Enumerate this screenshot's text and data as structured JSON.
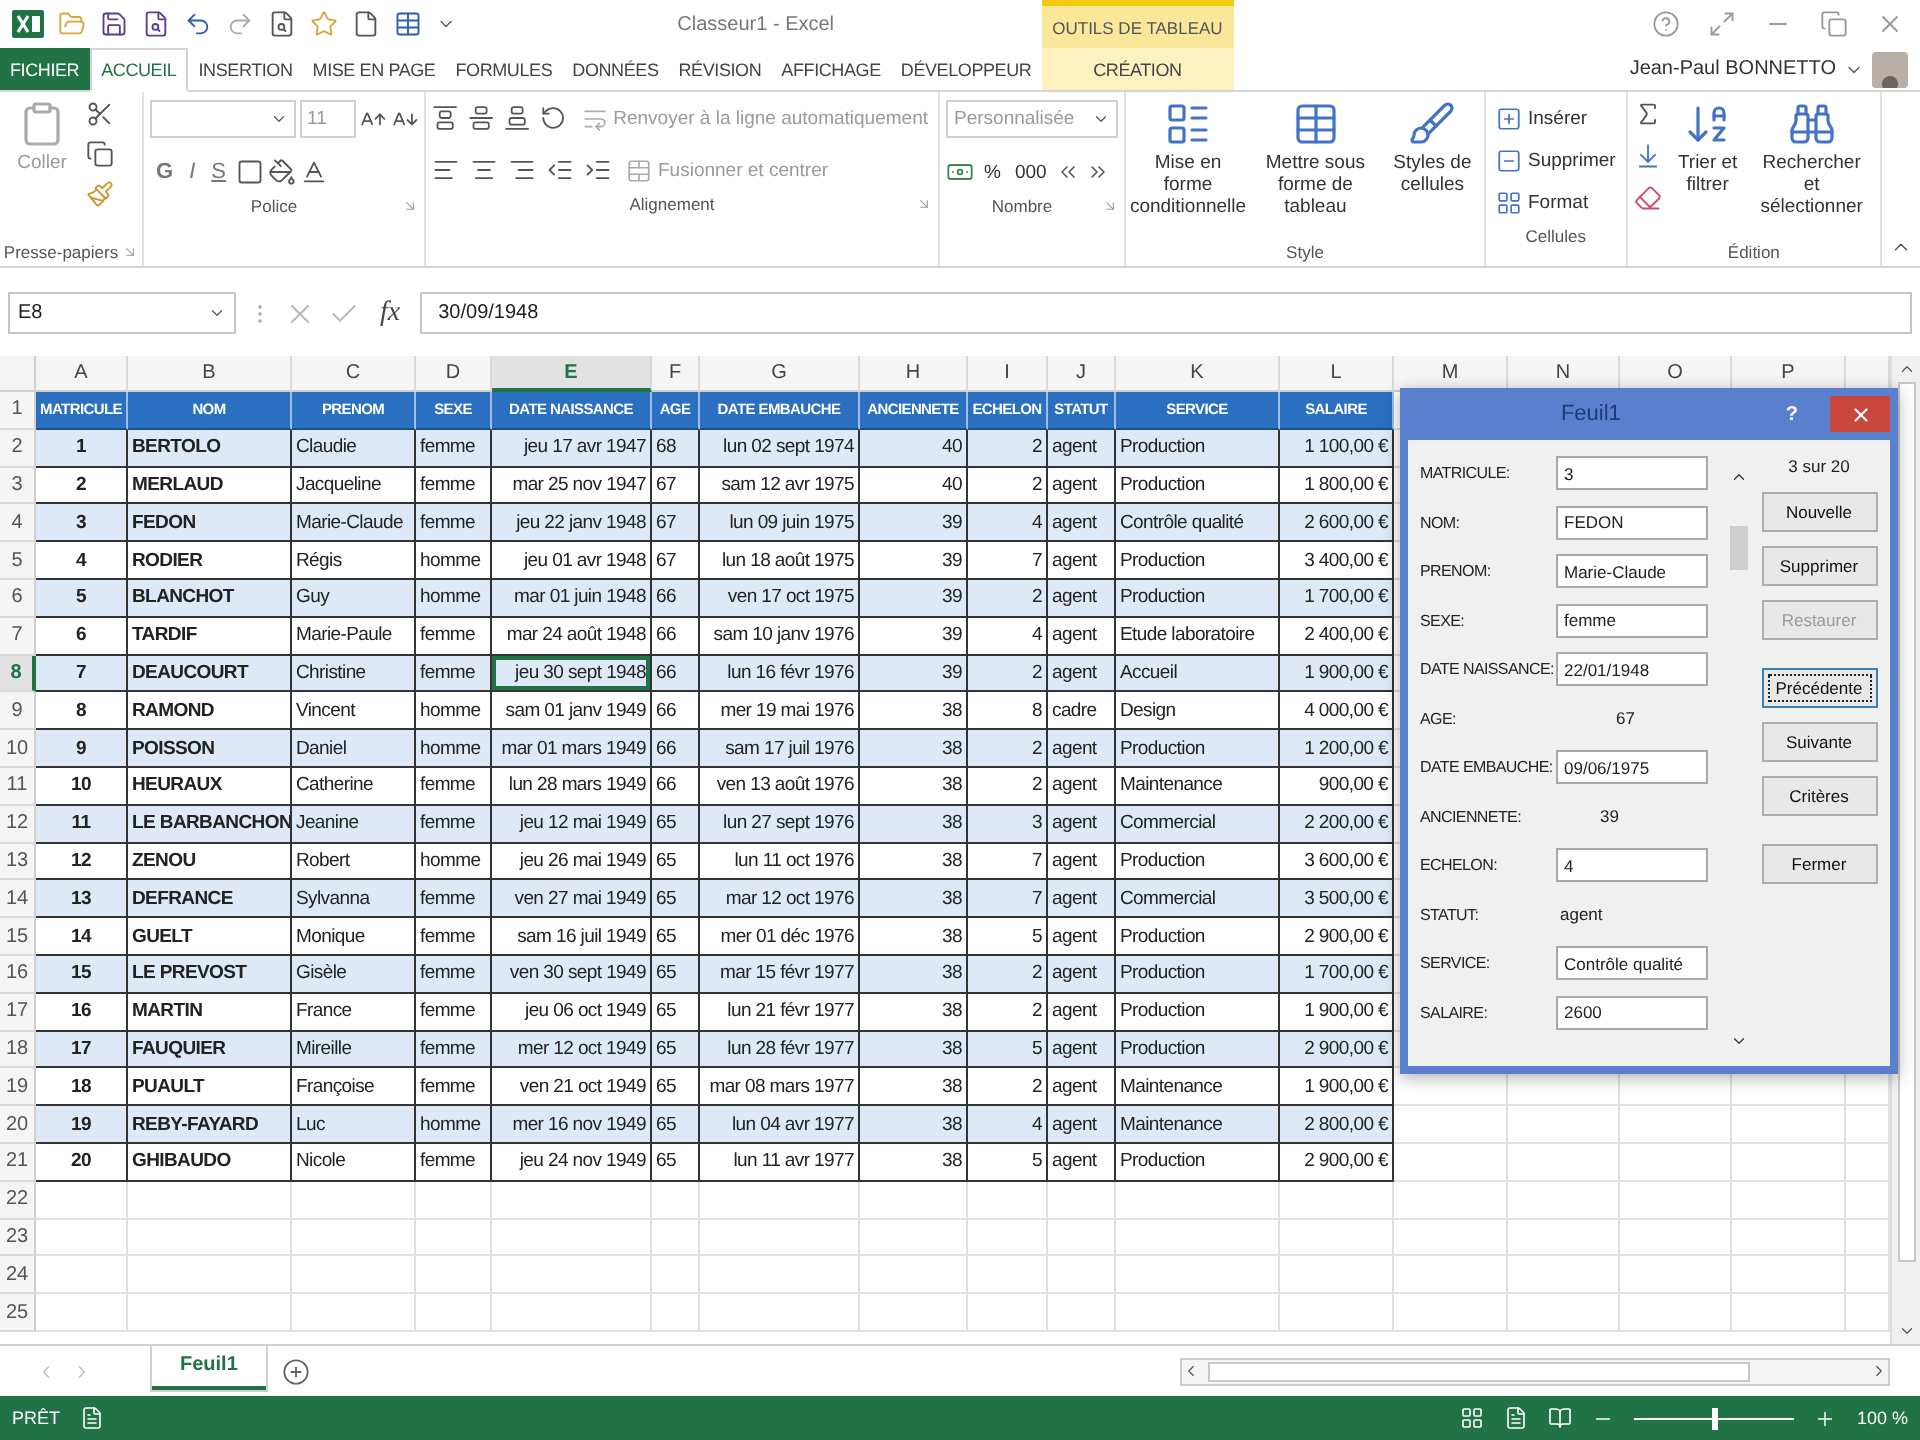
{
  "title_bar": {
    "app_title": "Classeur1 - Excel",
    "contextual_group": "OUTILS DE TABLEAU"
  },
  "tabs": [
    {
      "label": "FICHIER",
      "kind": "file",
      "selected": false
    },
    {
      "label": "ACCUEIL",
      "kind": "normal",
      "selected": true
    },
    {
      "label": "INSERTION",
      "kind": "normal",
      "selected": false
    },
    {
      "label": "MISE EN PAGE",
      "kind": "normal",
      "selected": false
    },
    {
      "label": "FORMULES",
      "kind": "normal",
      "selected": false
    },
    {
      "label": "DONNÉES",
      "kind": "normal",
      "selected": false
    },
    {
      "label": "RÉVISION",
      "kind": "normal",
      "selected": false
    },
    {
      "label": "AFFICHAGE",
      "kind": "normal",
      "selected": false
    },
    {
      "label": "DÉVELOPPEUR",
      "kind": "normal",
      "selected": false
    },
    {
      "label": "CRÉATION",
      "kind": "contextual",
      "selected": false
    }
  ],
  "user": {
    "name": "Jean-Paul BONNETTO"
  },
  "ribbon": [
    {
      "kind": "clipboard",
      "name": "Presse-papiers",
      "commands": [
        {
          "label": "Coller",
          "disabled": true
        }
      ]
    },
    {
      "kind": "font",
      "name": "Police",
      "size": "11",
      "styles": [
        "G",
        "I",
        "S"
      ]
    },
    {
      "kind": "alignment",
      "name": "Alignement",
      "commands": [
        {
          "label": "Renvoyer à la ligne automatiquement",
          "disabled": true
        },
        {
          "label": "Fusionner et centrer",
          "disabled": true
        }
      ]
    },
    {
      "kind": "number",
      "name": "Nombre",
      "format": "Personnalisée",
      "symbols": [
        "%",
        "000"
      ]
    },
    {
      "kind": "style",
      "name": "Style",
      "commands": [
        {
          "label": "Mise en forme conditionnelle",
          "disabled": false
        },
        {
          "label": "Mettre sous forme de tableau",
          "disabled": false
        },
        {
          "label": "Styles de cellules",
          "disabled": false
        }
      ]
    },
    {
      "kind": "cells",
      "name": "Cellules",
      "commands": [
        {
          "label": "Insérer",
          "disabled": false
        },
        {
          "label": "Supprimer",
          "disabled": false
        },
        {
          "label": "Format",
          "disabled": false
        }
      ]
    },
    {
      "kind": "editing",
      "name": "Édition",
      "commands": [
        {
          "label": "Trier et filtrer",
          "disabled": false
        },
        {
          "label": "Rechercher et sélectionner",
          "disabled": false
        }
      ]
    }
  ],
  "formula_bar": {
    "name_box": "E8",
    "function_button": "fx",
    "formula": "30/09/1948"
  },
  "sheet": {
    "columns": [
      {
        "label": "A",
        "selected": false
      },
      {
        "label": "B",
        "selected": false
      },
      {
        "label": "C",
        "selected": false
      },
      {
        "label": "D",
        "selected": false
      },
      {
        "label": "E",
        "selected": true
      },
      {
        "label": "F",
        "selected": false
      },
      {
        "label": "G",
        "selected": false
      },
      {
        "label": "H",
        "selected": false
      },
      {
        "label": "I",
        "selected": false
      },
      {
        "label": "J",
        "selected": false
      },
      {
        "label": "K",
        "selected": false
      },
      {
        "label": "L",
        "selected": false
      },
      {
        "label": "M",
        "selected": false
      },
      {
        "label": "N",
        "selected": false
      },
      {
        "label": "O",
        "selected": false
      },
      {
        "label": "P",
        "selected": false
      }
    ],
    "row_numbers": [
      {
        "label": "1",
        "selected": false
      },
      {
        "label": "2",
        "selected": false
      },
      {
        "label": "3",
        "selected": false
      },
      {
        "label": "4",
        "selected": false
      },
      {
        "label": "5",
        "selected": false
      },
      {
        "label": "6",
        "selected": false
      },
      {
        "label": "7",
        "selected": false
      },
      {
        "label": "8",
        "selected": true
      },
      {
        "label": "9",
        "selected": false
      },
      {
        "label": "10",
        "selected": false
      },
      {
        "label": "11",
        "selected": false
      },
      {
        "label": "12",
        "selected": false
      },
      {
        "label": "13",
        "selected": false
      },
      {
        "label": "14",
        "selected": false
      },
      {
        "label": "15",
        "selected": false
      },
      {
        "label": "16",
        "selected": false
      },
      {
        "label": "17",
        "selected": false
      },
      {
        "label": "18",
        "selected": false
      },
      {
        "label": "19",
        "selected": false
      },
      {
        "label": "20",
        "selected": false
      },
      {
        "label": "21",
        "selected": false
      },
      {
        "label": "22",
        "selected": false
      },
      {
        "label": "23",
        "selected": false
      },
      {
        "label": "24",
        "selected": false
      },
      {
        "label": "25",
        "selected": false
      }
    ],
    "table": {
      "header": [
        "MATRICULE",
        "NOM",
        "PRENOM",
        "SEXE",
        "DATE NAISSANCE",
        "AGE",
        "DATE EMBAUCHE",
        "ANCIENNETE",
        "ECHELON",
        "STATUT",
        "SERVICE",
        "SALAIRE"
      ],
      "rows": [
        [
          "1",
          "BERTOLO",
          "Claudie",
          "femme",
          "jeu 17 avr 1947",
          "68",
          "lun 02 sept 1974",
          "40",
          "2",
          "agent",
          "Production",
          "1 100,00 €"
        ],
        [
          "2",
          "MERLAUD",
          "Jacqueline",
          "femme",
          "mar 25 nov 1947",
          "67",
          "sam 12 avr 1975",
          "40",
          "2",
          "agent",
          "Production",
          "1 800,00 €"
        ],
        [
          "3",
          "FEDON",
          "Marie-Claude",
          "femme",
          "jeu 22 janv 1948",
          "67",
          "lun 09 juin 1975",
          "39",
          "4",
          "agent",
          "Contrôle qualité",
          "2 600,00 €"
        ],
        [
          "4",
          "RODIER",
          "Régis",
          "homme",
          "jeu 01 avr 1948",
          "67",
          "lun 18 août 1975",
          "39",
          "7",
          "agent",
          "Production",
          "3 400,00 €"
        ],
        [
          "5",
          "BLANCHOT",
          "Guy",
          "homme",
          "mar 01 juin 1948",
          "66",
          "ven 17 oct 1975",
          "39",
          "2",
          "agent",
          "Production",
          "1 700,00 €"
        ],
        [
          "6",
          "TARDIF",
          "Marie-Paule",
          "femme",
          "mar 24 août 1948",
          "66",
          "sam 10 janv 1976",
          "39",
          "4",
          "agent",
          "Etude laboratoire",
          "2 400,00 €"
        ],
        [
          "7",
          "DEAUCOURT",
          "Christine",
          "femme",
          "jeu 30 sept 1948",
          "66",
          "lun 16 févr 1976",
          "39",
          "2",
          "agent",
          "Accueil",
          "1 900,00 €"
        ],
        [
          "8",
          "RAMOND",
          "Vincent",
          "homme",
          "sam 01 janv 1949",
          "66",
          "mer 19 mai 1976",
          "38",
          "8",
          "cadre",
          "Design",
          "4 000,00 €"
        ],
        [
          "9",
          "POISSON",
          "Daniel",
          "homme",
          "mar 01 mars 1949",
          "66",
          "sam 17 juil 1976",
          "38",
          "2",
          "agent",
          "Production",
          "1 200,00 €"
        ],
        [
          "10",
          "HEURAUX",
          "Catherine",
          "femme",
          "lun 28 mars 1949",
          "66",
          "ven 13 août 1976",
          "38",
          "2",
          "agent",
          "Maintenance",
          "900,00 €"
        ],
        [
          "11",
          "LE BARBANCHON",
          "Jeanine",
          "femme",
          "jeu 12 mai 1949",
          "65",
          "lun 27 sept 1976",
          "38",
          "3",
          "agent",
          "Commercial",
          "2 200,00 €"
        ],
        [
          "12",
          "ZENOU",
          "Robert",
          "homme",
          "jeu 26 mai 1949",
          "65",
          "lun 11 oct 1976",
          "38",
          "7",
          "agent",
          "Production",
          "3 600,00 €"
        ],
        [
          "13",
          "DEFRANCE",
          "Sylvanna",
          "femme",
          "ven 27 mai 1949",
          "65",
          "mar 12 oct 1976",
          "38",
          "7",
          "agent",
          "Commercial",
          "3 500,00 €"
        ],
        [
          "14",
          "GUELT",
          "Monique",
          "femme",
          "sam 16 juil 1949",
          "65",
          "mer 01 déc 1976",
          "38",
          "5",
          "agent",
          "Production",
          "2 900,00 €"
        ],
        [
          "15",
          "LE PREVOST",
          "Gisèle",
          "femme",
          "ven 30 sept 1949",
          "65",
          "mar 15 févr 1977",
          "38",
          "2",
          "agent",
          "Production",
          "1 700,00 €"
        ],
        [
          "16",
          "MARTIN",
          "France",
          "femme",
          "jeu 06 oct 1949",
          "65",
          "lun 21 févr 1977",
          "38",
          "2",
          "agent",
          "Production",
          "1 900,00 €"
        ],
        [
          "17",
          "FAUQUIER",
          "Mireille",
          "femme",
          "mer 12 oct 1949",
          "65",
          "lun 28 févr 1977",
          "38",
          "5",
          "agent",
          "Production",
          "2 900,00 €"
        ],
        [
          "18",
          "PUAULT",
          "Françoise",
          "femme",
          "ven 21 oct 1949",
          "65",
          "mar 08 mars 1977",
          "38",
          "2",
          "agent",
          "Maintenance",
          "1 900,00 €"
        ],
        [
          "19",
          "REBY-FAYARD",
          "Luc",
          "homme",
          "mer 16 nov 1949",
          "65",
          "lun 04 avr 1977",
          "38",
          "4",
          "agent",
          "Maintenance",
          "2 800,00 €"
        ],
        [
          "20",
          "GHIBAUDO",
          "Nicole",
          "femme",
          "jeu 24 nov 1949",
          "65",
          "lun 11 avr 1977",
          "38",
          "5",
          "agent",
          "Production",
          "2 900,00 €"
        ]
      ]
    }
  },
  "dialog": {
    "title": "Feuil1",
    "help": "?",
    "record_counter": "3 sur 20",
    "fields": [
      {
        "label": "MATRICULE:",
        "value": "3",
        "kind": "input"
      },
      {
        "label": "NOM:",
        "value": "FEDON",
        "kind": "input"
      },
      {
        "label": "PRENOM:",
        "value": "Marie-Claude",
        "kind": "input"
      },
      {
        "label": "SEXE:",
        "value": "femme",
        "kind": "input"
      },
      {
        "label": "DATE NAISSANCE:",
        "value": "22/01/1948",
        "kind": "input"
      },
      {
        "label": "AGE:",
        "value": "67",
        "kind": "static"
      },
      {
        "label": "DATE EMBAUCHE:",
        "value": "09/06/1975",
        "kind": "input"
      },
      {
        "label": "ANCIENNETE:",
        "value": "39",
        "kind": "static"
      },
      {
        "label": "ECHELON:",
        "value": "4",
        "kind": "input"
      },
      {
        "label": "STATUT:",
        "value": "agent",
        "kind": "static"
      },
      {
        "label": "SERVICE:",
        "value": "Contrôle qualité",
        "kind": "input"
      },
      {
        "label": "SALAIRE:",
        "value": "2600",
        "kind": "input"
      }
    ],
    "button_groups": [
      [
        {
          "label": "Nouvelle",
          "disabled": false,
          "focused": false
        },
        {
          "label": "Supprimer",
          "disabled": false,
          "focused": false
        },
        {
          "label": "Restaurer",
          "disabled": true,
          "focused": false
        }
      ],
      [
        {
          "label": "Précédente",
          "disabled": false,
          "focused": true
        },
        {
          "label": "Suivante",
          "disabled": false,
          "focused": false
        },
        {
          "label": "Critères",
          "disabled": false,
          "focused": false
        }
      ],
      [
        {
          "label": "Fermer",
          "disabled": false,
          "focused": false
        }
      ]
    ]
  },
  "sheet_tabs": [
    {
      "label": "Feuil1",
      "selected": true
    }
  ],
  "status_bar": {
    "status": "PRÊT",
    "zoom": {
      "level": 0.5,
      "reading": "100 %"
    }
  }
}
